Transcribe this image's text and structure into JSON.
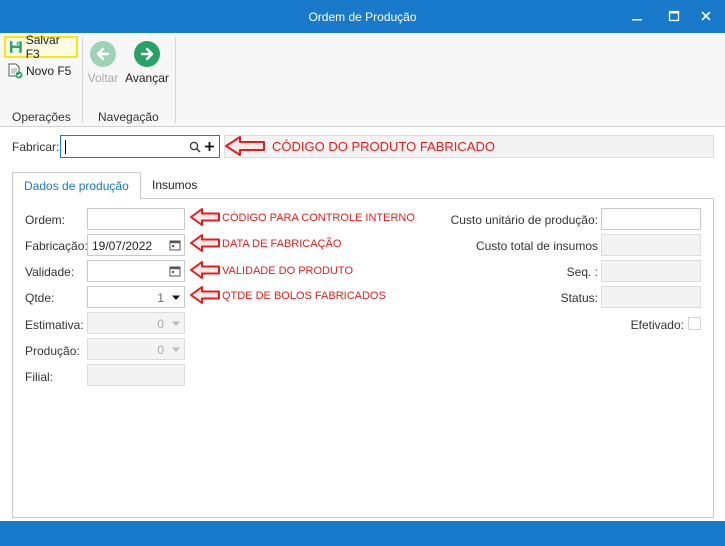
{
  "window": {
    "title": "Ordem de Produção"
  },
  "ribbon": {
    "save_label": "Salvar F3",
    "new_label": "Novo F5",
    "back_label": "Voltar",
    "forward_label": "Avançar",
    "group_operations": "Operações",
    "group_navigation": "Navegação"
  },
  "fabricar": {
    "label": "Fabricar:",
    "value": "",
    "annotation": "CÓDIGO DO PRODUTO FABRICADO"
  },
  "tabs": [
    {
      "label": "Dados de produção",
      "active": true
    },
    {
      "label": "Insumos",
      "active": false
    }
  ],
  "form": {
    "ordem": {
      "label": "Ordem:",
      "value": "",
      "annotation": "CÓDIGO PARA CONTROLE INTERNO"
    },
    "fabricacao": {
      "label": "Fabricação:",
      "value": "19/07/2022",
      "annotation": "DATA DE FABRICAÇÃO"
    },
    "validade": {
      "label": "Validade:",
      "value": "",
      "annotation": "VALIDADE DO PRODUTO"
    },
    "qtde": {
      "label": "Qtde:",
      "value": "1",
      "annotation": "QTDE DE BOLOS FABRICADOS"
    },
    "estimativa": {
      "label": "Estimativa:",
      "value": "0"
    },
    "producao": {
      "label": "Produção:",
      "value": "0"
    },
    "filial": {
      "label": "Filial:",
      "value": ""
    },
    "custo_unitario": {
      "label": "Custo unitário de produção:",
      "value": ""
    },
    "custo_total": {
      "label": "Custo total de insumos",
      "value": ""
    },
    "seq": {
      "label": "Seq. :",
      "value": ""
    },
    "status": {
      "label": "Status:",
      "value": ""
    },
    "efetivado": {
      "label": "Efetivado:",
      "checked": false
    }
  },
  "colors": {
    "titlebar": "#1979ca",
    "annotation": "#e02020",
    "nav_green": "#2aa265",
    "nav_green_disabled": "#9fd3b8",
    "save_highlight": "#f5e61b"
  },
  "icons": [
    "minimize-icon",
    "maximize-icon",
    "close-icon",
    "save-icon",
    "new-doc-icon",
    "arrow-left-icon",
    "arrow-right-icon",
    "search-icon",
    "plus-icon",
    "calendar-icon",
    "dropdown-arrow-icon",
    "red-arrow-icon"
  ]
}
